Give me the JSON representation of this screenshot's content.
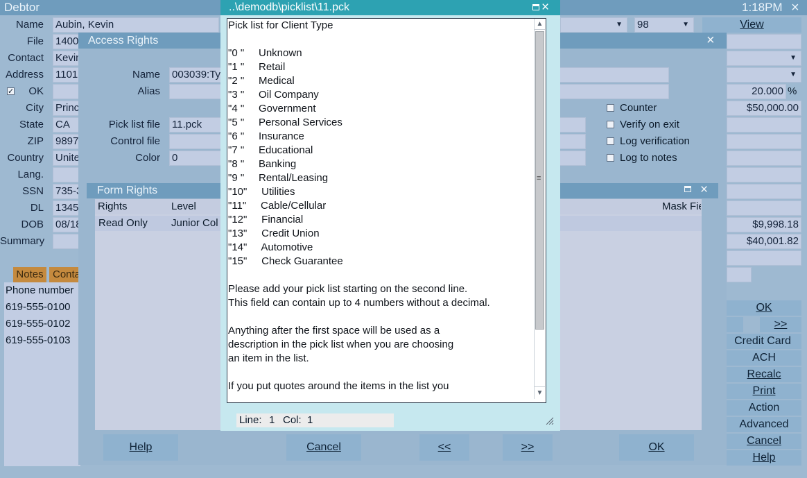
{
  "debtor": {
    "title": "Debtor",
    "time": "1:18PM",
    "close": "×",
    "labels": {
      "name": "Name",
      "file": "File",
      "contact": "Contact",
      "address": "Address",
      "ok": "OK",
      "city": "City",
      "state": "State",
      "zip": "ZIP",
      "country": "Country",
      "lang": "Lang.",
      "ssn": "SSN",
      "dl": "DL",
      "dob": "DOB",
      "summary": "Summary"
    },
    "values": {
      "name": "Aubin, Kevin",
      "file": "1400",
      "contact": "Kevin",
      "address": "1101",
      "city": "Princ",
      "state": "CA",
      "zip": "9897",
      "country": "Unite",
      "lang": "",
      "ssn": "735-3",
      "dl": "1345",
      "dob": "08/18"
    },
    "top_right_select": "98",
    "view_button": "View",
    "right_values": {
      "percent": "20.000",
      "percent_sign": "%",
      "amount1": "$50,000.00",
      "amount2": "$9,998.18",
      "amount3": "$40,001.82"
    },
    "tabs": [
      "Notes",
      "Conta"
    ],
    "phone_header": "Phone number",
    "phones": [
      "619-555-0100",
      "619-555-0102",
      "619-555-0103"
    ],
    "side_buttons": {
      "ok": "OK",
      "next": ">>",
      "credit_card": "Credit Card",
      "ach": "ACH",
      "recalc": "Recalc",
      "print": "Print",
      "action": "Action",
      "advanced": "Advanced",
      "cancel": "Cancel",
      "help": "Help"
    }
  },
  "access_rights": {
    "title": "Access Rights",
    "close": "×",
    "labels": {
      "name": "Name",
      "alias": "Alias",
      "pick_list_file": "Pick list file",
      "control_file": "Control file",
      "color": "Color"
    },
    "values": {
      "name": "003039:Ty",
      "alias": "",
      "pick_list_file": "11.pck",
      "control_file": "",
      "color": "0"
    },
    "checkboxes": [
      "Counter",
      "Verify on exit",
      "Log verification",
      "Log to notes"
    ],
    "buttons": {
      "help": "Help",
      "cancel": "Cancel",
      "prev": "<<",
      "next": ">>",
      "ok": "OK"
    }
  },
  "form_rights": {
    "title": "Form Rights",
    "columns": [
      "Rights",
      "Level",
      "Mask Fie"
    ],
    "rows": [
      {
        "rights": "Read Only",
        "level": "Junior Col"
      }
    ]
  },
  "editor": {
    "title": "..\\demodb\\picklist\\11.pck",
    "lines": [
      "Pick list for Client Type",
      "",
      "\"0 \"     Unknown",
      "\"1 \"     Retail",
      "\"2 \"     Medical",
      "\"3 \"     Oil Company",
      "\"4 \"     Government",
      "\"5 \"     Personal Services",
      "\"6 \"     Insurance",
      "\"7 \"     Educational",
      "\"8 \"     Banking",
      "\"9 \"     Rental/Leasing",
      "\"10\"     Utilities",
      "\"11\"     Cable/Cellular",
      "\"12\"     Financial",
      "\"13\"     Credit Union",
      "\"14\"     Automotive",
      "\"15\"     Check Guarantee",
      "",
      "Please add your pick list starting on the second line.",
      "This field can contain up to 4 numbers without a decimal.",
      "",
      "Anything after the first space will be used as a",
      "description in the pick list when you are choosing",
      "an item in the list.",
      "",
      "If you put quotes around the items in the list you"
    ],
    "status": {
      "line_label": "Line:",
      "line": "1",
      "col_label": "Col:",
      "col": "1"
    }
  }
}
